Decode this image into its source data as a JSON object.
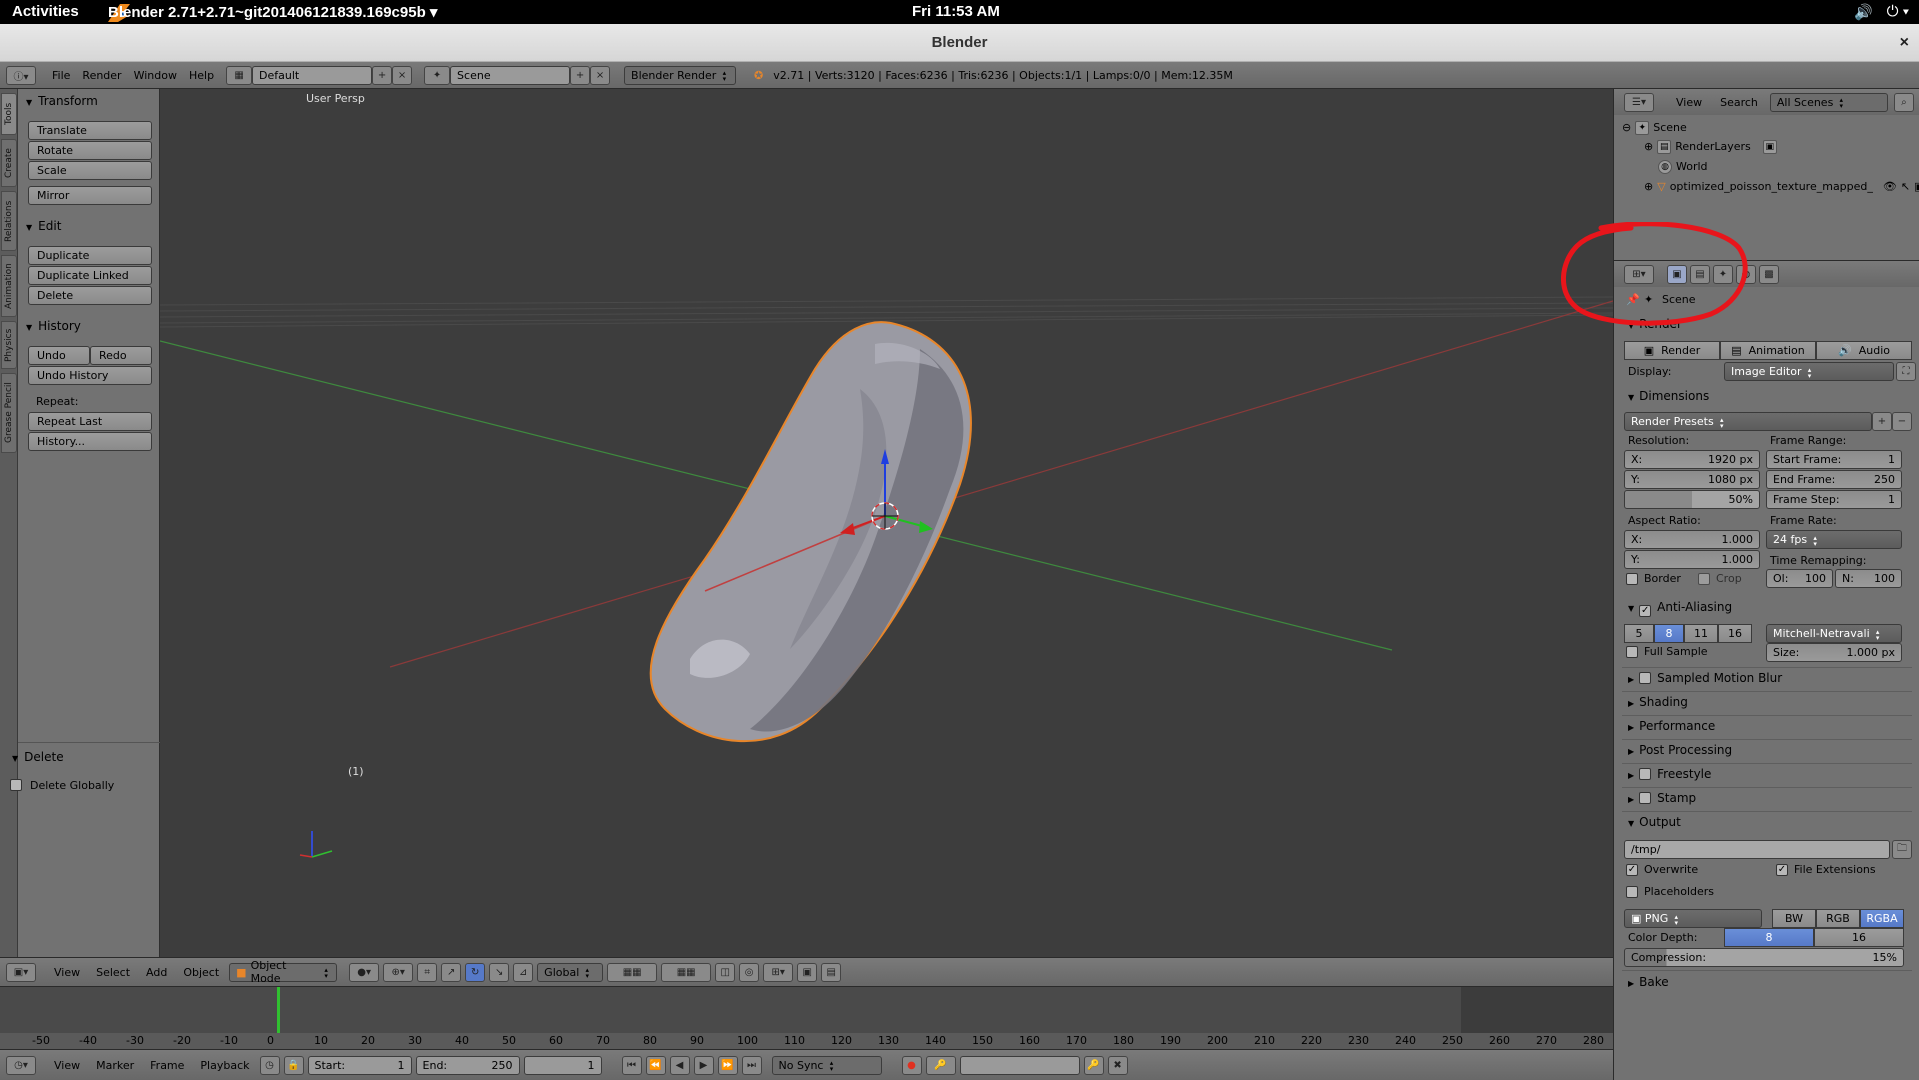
{
  "gnome": {
    "activities": "Activities",
    "app_title": "Blender 2.71+2.71~git201406121839.169c95b ▾",
    "clock": "Fri 11:53 AM",
    "tray_icons": [
      "volume-icon",
      "power-icon"
    ]
  },
  "window": {
    "title": "Blender",
    "close": "×"
  },
  "info_header": {
    "menus": [
      "File",
      "Render",
      "Window",
      "Help"
    ],
    "screen_layout": "Default",
    "scene": "Scene",
    "engine": "Blender Render",
    "stats": "v2.71 | Verts:3120 | Faces:6236 | Tris:6236 | Objects:1/1 | Lamps:0/0 | Mem:12.35M"
  },
  "tool_tabs": [
    "Tools",
    "Create",
    "Relations",
    "Animation",
    "Physics",
    "Grease Pencil"
  ],
  "tool_shelf": {
    "transform": {
      "title": "Transform",
      "buttons": [
        "Translate",
        "Rotate",
        "Scale",
        "Mirror"
      ]
    },
    "edit": {
      "title": "Edit",
      "buttons": [
        "Duplicate",
        "Duplicate Linked",
        "Delete"
      ]
    },
    "history": {
      "title": "History",
      "undo": "Undo",
      "redo": "Redo",
      "undo_history": "Undo History",
      "repeat_label": "Repeat:",
      "repeat_last": "Repeat Last",
      "history_btn": "History..."
    },
    "operator": {
      "title": "Delete",
      "option": "Delete Globally"
    }
  },
  "viewport": {
    "view_label": "User Persp",
    "frame_label": "(1)"
  },
  "vp_header": {
    "menus": [
      "View",
      "Select",
      "Add",
      "Object"
    ],
    "mode": "Object Mode",
    "orientation": "Global"
  },
  "timeline": {
    "ticks": [
      "-50",
      "-40",
      "-30",
      "-20",
      "-10",
      "0",
      "10",
      "20",
      "30",
      "40",
      "50",
      "60",
      "70",
      "80",
      "90",
      "100",
      "110",
      "120",
      "130",
      "140",
      "150",
      "160",
      "170",
      "180",
      "190",
      "200",
      "210",
      "220",
      "230",
      "240",
      "250",
      "260",
      "270",
      "280"
    ],
    "menus": [
      "View",
      "Marker",
      "Frame",
      "Playback"
    ],
    "start_label": "Start:",
    "start": "1",
    "end_label": "End:",
    "end": "250",
    "current": "1",
    "sync": "No Sync"
  },
  "outliner": {
    "menus": [
      "View",
      "Search"
    ],
    "filter": "All Scenes",
    "items": [
      "Scene",
      "RenderLayers",
      "World",
      "optimized_poisson_texture_mapped_"
    ]
  },
  "properties": {
    "context": "Scene",
    "render": {
      "title": "Render",
      "buttons": [
        "Render",
        "Animation",
        "Audio"
      ],
      "display_label": "Display:",
      "display": "Image Editor"
    },
    "dimensions": {
      "title": "Dimensions",
      "presets": "Render Presets",
      "resolution_label": "Resolution:",
      "res_x_label": "X:",
      "res_x": "1920 px",
      "res_y_label": "Y:",
      "res_y": "1080 px",
      "res_pct": "50%",
      "frame_range_label": "Frame Range:",
      "start_label": "Start Frame:",
      "start": "1",
      "end_label": "End Frame:",
      "end": "250",
      "step_label": "Frame Step:",
      "step": "1",
      "aspect_label": "Aspect Ratio:",
      "asp_x_label": "X:",
      "asp_x": "1.000",
      "asp_y_label": "Y:",
      "asp_y": "1.000",
      "frame_rate_label": "Frame Rate:",
      "frame_rate": "24 fps",
      "time_remap_label": "Time Remapping:",
      "old_label": "Ol:",
      "old": "100",
      "new_label": "N:",
      "new": "100",
      "border": "Border",
      "crop": "Crop"
    },
    "aa": {
      "title": "Anti-Aliasing",
      "samples": [
        "5",
        "8",
        "11",
        "16"
      ],
      "selected_sample": "8",
      "filter": "Mitchell-Netravali",
      "full_sample": "Full Sample",
      "size_label": "Size:",
      "size": "1.000 px"
    },
    "collapsed": [
      "Sampled Motion Blur",
      "Shading",
      "Performance",
      "Post Processing",
      "Freestyle",
      "Stamp"
    ],
    "output": {
      "title": "Output",
      "path": "/tmp/",
      "overwrite": "Overwrite",
      "file_ext": "File Extensions",
      "placeholders": "Placeholders",
      "format": "PNG",
      "color_modes": [
        "BW",
        "RGB",
        "RGBA"
      ],
      "color_mode_selected": "RGBA",
      "depth_label": "Color Depth:",
      "depths": [
        "8",
        "16"
      ],
      "compression_label": "Compression:",
      "compression": "15%"
    },
    "bake": "Bake"
  },
  "colors": {
    "accent": "#5679c8",
    "annotation": "#e8151b",
    "mesh": "#8a8a94",
    "select_outline": "#e8862a"
  }
}
